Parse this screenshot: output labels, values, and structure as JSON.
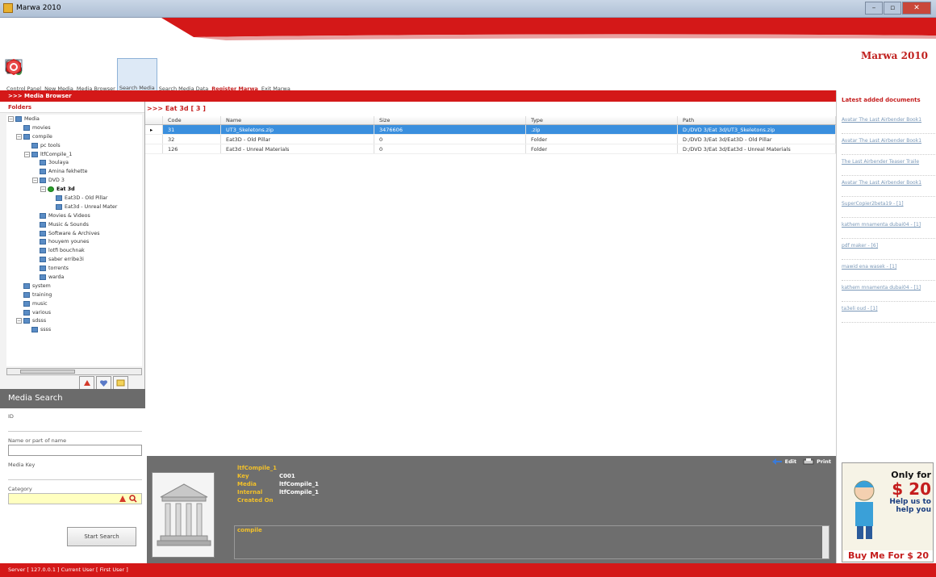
{
  "window": {
    "title": "Marwa 2010",
    "min": "–",
    "max": "▫",
    "close": "✕"
  },
  "banner": {
    "brand": "Marwa 2010"
  },
  "toolbar": [
    {
      "label": "Control Panel",
      "icon": "control-panel-icon",
      "active": false,
      "red": false
    },
    {
      "label": "New Media",
      "icon": "new-media-icon",
      "active": false,
      "red": false
    },
    {
      "label": "Media Browser",
      "icon": "media-browser-icon",
      "active": false,
      "red": false
    },
    {
      "label": "Search Media",
      "icon": "search-media-icon",
      "active": true,
      "red": false
    },
    {
      "label": "Search Media Data",
      "icon": "search-media-data-icon",
      "active": false,
      "red": false
    },
    {
      "label": "Register Marwa",
      "icon": "register-icon",
      "active": false,
      "red": true
    },
    {
      "label": "Exit Marwa",
      "icon": "exit-icon",
      "active": false,
      "red": false
    }
  ],
  "breadcrumb": ">>> Media Browser",
  "folders": {
    "header": "Folders",
    "tree": [
      {
        "label": "Media",
        "level": 0,
        "exp": "⊟",
        "sel": false,
        "green": false
      },
      {
        "label": "movies",
        "level": 1,
        "exp": "",
        "sel": false,
        "green": false
      },
      {
        "label": "compile",
        "level": 1,
        "exp": "⊟",
        "sel": false,
        "green": false
      },
      {
        "label": "pc tools",
        "level": 2,
        "exp": "",
        "sel": false,
        "green": false
      },
      {
        "label": "ltfCompile_1",
        "level": 2,
        "exp": "⊟",
        "sel": false,
        "green": false
      },
      {
        "label": "3oulaya",
        "level": 3,
        "exp": "",
        "sel": false,
        "green": false
      },
      {
        "label": "Amina fekhette",
        "level": 3,
        "exp": "",
        "sel": false,
        "green": false
      },
      {
        "label": "DVD 3",
        "level": 3,
        "exp": "⊟",
        "sel": false,
        "green": false
      },
      {
        "label": "Eat 3d",
        "level": 4,
        "exp": "⊟",
        "sel": true,
        "green": true
      },
      {
        "label": "Eat3D - Old Pillar",
        "level": 5,
        "exp": "",
        "sel": false,
        "green": false
      },
      {
        "label": "Eat3d - Unreal Mater",
        "level": 5,
        "exp": "",
        "sel": false,
        "green": false
      },
      {
        "label": "Movies & Videos",
        "level": 3,
        "exp": "",
        "sel": false,
        "green": false
      },
      {
        "label": "Music & Sounds",
        "level": 3,
        "exp": "",
        "sel": false,
        "green": false
      },
      {
        "label": "Software & Archives",
        "level": 3,
        "exp": "",
        "sel": false,
        "green": false
      },
      {
        "label": "houyem younes",
        "level": 3,
        "exp": "",
        "sel": false,
        "green": false
      },
      {
        "label": "lotfi bouchnak",
        "level": 3,
        "exp": "",
        "sel": false,
        "green": false
      },
      {
        "label": "saber erribe3i",
        "level": 3,
        "exp": "",
        "sel": false,
        "green": false
      },
      {
        "label": "torrents",
        "level": 3,
        "exp": "",
        "sel": false,
        "green": false
      },
      {
        "label": "warda",
        "level": 3,
        "exp": "",
        "sel": false,
        "green": false
      },
      {
        "label": "system",
        "level": 1,
        "exp": "",
        "sel": false,
        "green": false
      },
      {
        "label": "training",
        "level": 1,
        "exp": "",
        "sel": false,
        "green": false
      },
      {
        "label": "music",
        "level": 1,
        "exp": "",
        "sel": false,
        "green": false
      },
      {
        "label": "various",
        "level": 1,
        "exp": "",
        "sel": false,
        "green": false
      },
      {
        "label": "sdsss",
        "level": 1,
        "exp": "⊟",
        "sel": false,
        "green": false
      },
      {
        "label": "ssss",
        "level": 2,
        "exp": "",
        "sel": false,
        "green": false
      }
    ],
    "scroll_label": "III"
  },
  "media_search": {
    "title": "Media Search",
    "id_label": "ID",
    "name_label": "Name or part of name",
    "key_label": "Media Key",
    "category_label": "Category",
    "start_button": "Start Search"
  },
  "main": {
    "title": ">>> Eat 3d [ 3 ]",
    "columns": [
      "",
      "Code",
      "Name",
      "Size",
      "Type",
      "Path"
    ],
    "rows": [
      {
        "marker": "▸",
        "code": "31",
        "name": "UT3_Skeletons.zip",
        "size": "3476606",
        "type": ".zip",
        "path": "D:/DVD 3/Eat 3d/UT3_Skeletons.zip",
        "selected": true
      },
      {
        "marker": "",
        "code": "32",
        "name": "Eat3D - Old Pillar",
        "size": "0",
        "type": "Folder",
        "path": "D:/DVD 3/Eat 3d/Eat3D - Old Pillar",
        "selected": false
      },
      {
        "marker": "",
        "code": "126",
        "name": "Eat3d - Unreal Materials",
        "size": "0",
        "type": "Folder",
        "path": "D:/DVD 3/Eat 3d/Eat3d - Unreal Materials",
        "selected": false
      }
    ]
  },
  "detail": {
    "title": "ltfCompile_1",
    "fields": [
      {
        "k": "Key",
        "v": "C001"
      },
      {
        "k": "Media",
        "v": "ltfCompile_1"
      },
      {
        "k": "Internal",
        "v": "ltfCompile_1"
      },
      {
        "k": "Created On",
        "v": ""
      }
    ],
    "notes": "compile",
    "edit_label": "Edit",
    "print_label": "Print"
  },
  "latest": {
    "title": "Latest added documents",
    "items": [
      "Avatar The Last Airbender Book1",
      "Avatar The Last Airbender Book1",
      "The Last Airbender Teaser Traile",
      "Avatar The Last Airbender Book1",
      "SuperCopier2beta19 - [1]",
      "kathem mnamenta dubai04 - [1]",
      "pdf maker - [6]",
      "mawid ena wasek - [1]",
      "kathem mnamenta dubai04 - [1]",
      "ta3eli oud - [1]"
    ]
  },
  "ad": {
    "only": "Only for",
    "price": "$ 20",
    "help": "Help us to help you",
    "buy": "Buy Me For $ 20"
  },
  "status": "Server [ 127.0.0.1 ] Current User [ First User ]",
  "colors": {
    "accent": "#d41818",
    "selection": "#3a8fde",
    "detail_bg": "#6e6e6e"
  }
}
